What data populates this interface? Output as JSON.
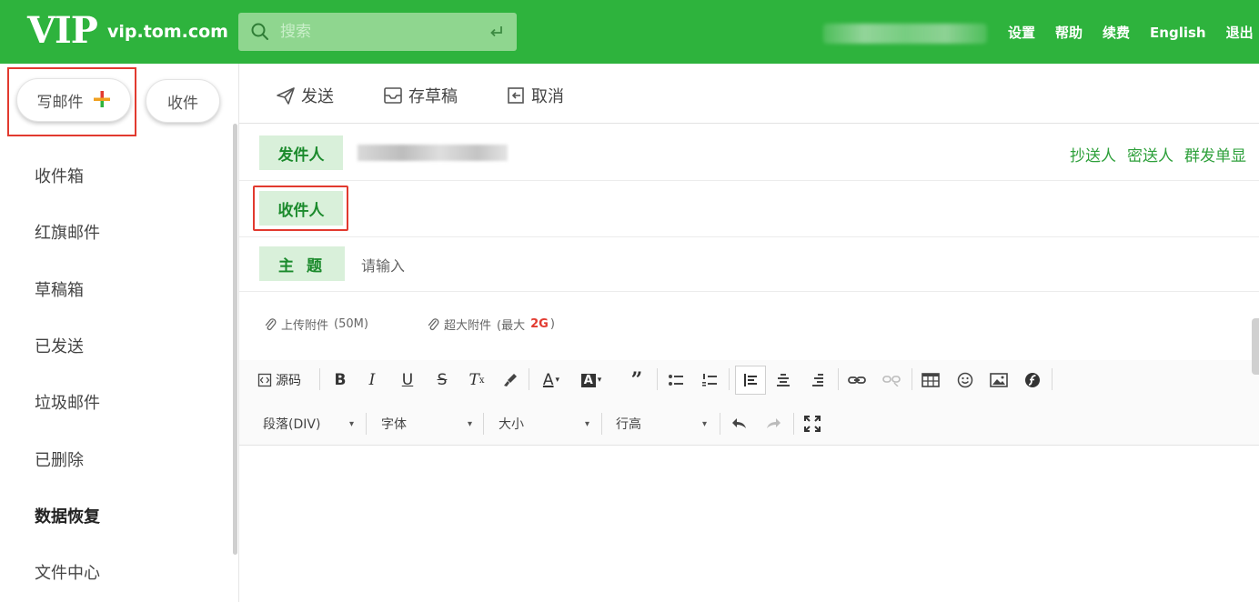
{
  "header": {
    "logo": "VIP",
    "domain": "vip.tom.com",
    "search_placeholder": "搜索",
    "links": [
      "设置",
      "帮助",
      "续费",
      "English",
      "退出"
    ]
  },
  "sidebar": {
    "compose_label": "写邮件",
    "receive_label": "收件",
    "folders": [
      "收件箱",
      "红旗邮件",
      "草稿箱",
      "已发送",
      "垃圾邮件",
      "已删除",
      "数据恢复",
      "文件中心"
    ]
  },
  "toolbar": {
    "send_label": "发送",
    "draft_label": "存草稿",
    "cancel_label": "取消"
  },
  "compose": {
    "from_label": "发件人",
    "to_label": "收件人",
    "subject_label": "主 题",
    "subject_placeholder": "请输入",
    "cc_links": [
      "抄送人",
      "密送人",
      "群发单显"
    ]
  },
  "attachments": {
    "upload_label": "上传附件",
    "upload_limit": "(50M)",
    "large_label": "超大附件",
    "large_prefix": "(最大",
    "large_size": "2G",
    "large_suffix": ")"
  },
  "editor": {
    "source_label": "源码",
    "paragraph_select": "段落(DIV)",
    "font_select": "字体",
    "size_select": "大小",
    "lineheight_select": "行高"
  },
  "colors": {
    "brand_green": "#2eb33d",
    "label_bg": "#d9f0da",
    "highlight_red": "#e23a2f"
  }
}
